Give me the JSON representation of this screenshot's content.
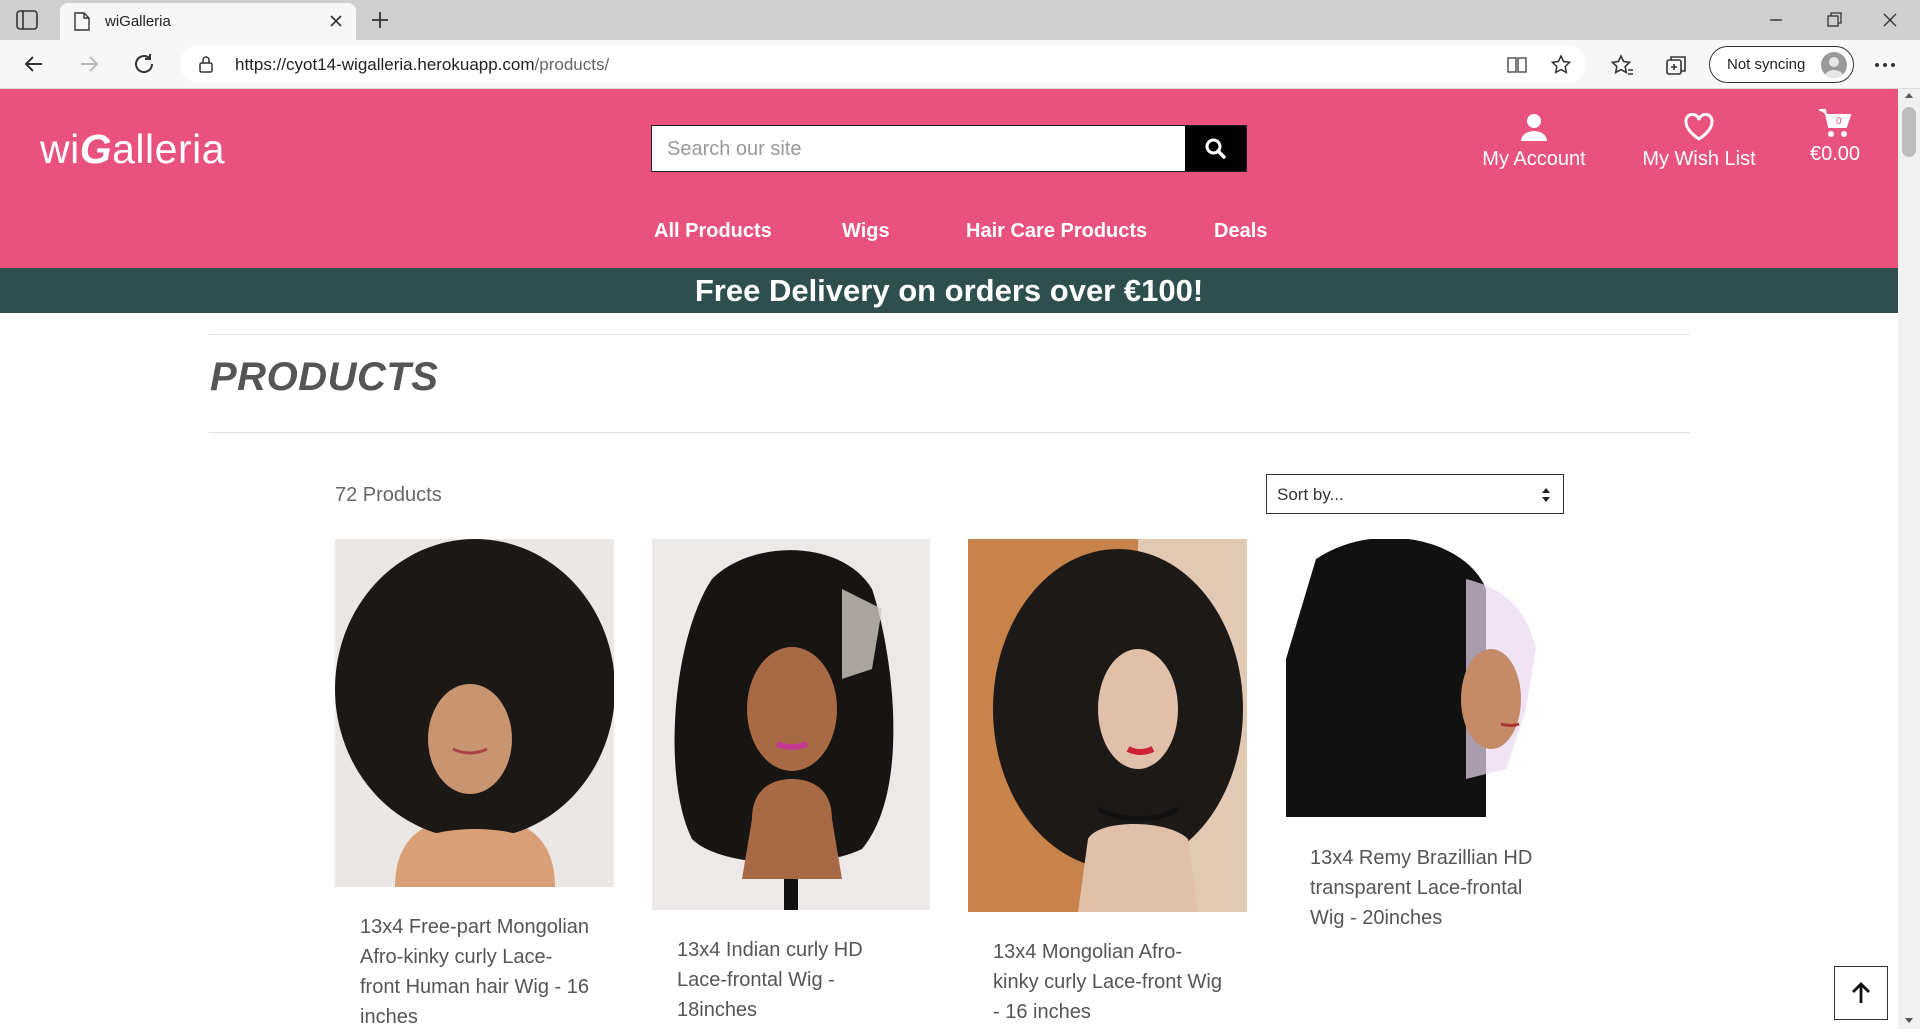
{
  "browser": {
    "tab_title": "wiGalleria",
    "url_host": "https://cyot14-wigalleria.herokuapp.com",
    "url_path": "/products/",
    "sync_label": "Not syncing"
  },
  "site": {
    "logo_prefix": "wi",
    "logo_italic": "G",
    "logo_suffix": "alleria",
    "search_placeholder": "Search our site",
    "account_label": "My Account",
    "wishlist_label": "My Wish List",
    "cart_total": "€0.00",
    "cart_count": "0",
    "nav": [
      "All Products",
      "Wigs",
      "Hair Care Products",
      "Deals"
    ],
    "banner": "Free Delivery on orders over €100!"
  },
  "colors": {
    "brand_pink": "#e8527d",
    "banner_teal": "#2f4f4f"
  },
  "main": {
    "page_title": "PRODUCTS",
    "product_count": "72 Products",
    "sort_label": "Sort by..."
  },
  "products": [
    {
      "name_lines": [
        "13x4 Free-part Mongolian",
        "Afro-kinky curly Lace-",
        "front Human hair Wig - 16",
        "inches"
      ]
    },
    {
      "name_lines": [
        "13x4 Indian curly HD",
        "Lace-frontal Wig -",
        "18inches"
      ]
    },
    {
      "name_lines": [
        "13x4 Mongolian Afro-",
        "kinky curly Lace-front Wig",
        "- 16 inches"
      ]
    },
    {
      "name_lines": [
        "13x4 Remy Brazillian HD",
        "transparent Lace-frontal",
        "Wig - 20inches"
      ]
    }
  ]
}
